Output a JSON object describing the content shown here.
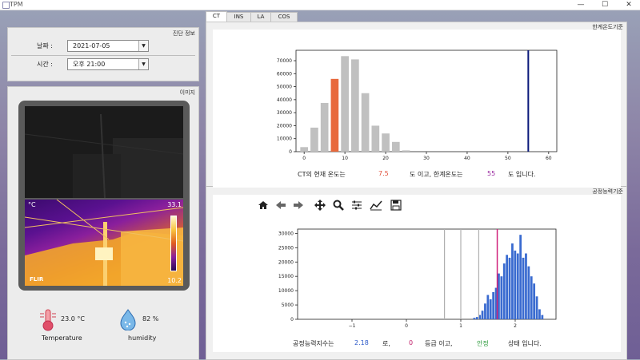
{
  "window": {
    "title": "TPM",
    "minimize": "—",
    "maximize": "☐",
    "close": "✕"
  },
  "diag": {
    "title": "진단 정보",
    "date_label": "날짜 :",
    "date_value": "2021-07-05",
    "time_label": "시간 :",
    "time_value": "오후 21:00"
  },
  "image_panel": {
    "title": "이미지",
    "camera": {
      "unit_label": "°C",
      "max_temp": "33.1",
      "min_temp": "10.2",
      "brand": "FLIR"
    }
  },
  "sensors": {
    "temperature_value": "23.0 °C",
    "temperature_label": "Temperature",
    "humidity_value": "82 %",
    "humidity_label": "humidity"
  },
  "tabs": [
    "CT",
    "INS",
    "LA",
    "COS"
  ],
  "limit_chart": {
    "group_title": "한계온도기준",
    "info": {
      "prefix": "CT의 현재 온도는",
      "current": "7.5",
      "mid": "도 이고, 한계온도는",
      "limit": "55",
      "suffix": "도 입니다."
    },
    "colors": {
      "bar": "#c0c0c0",
      "highlight": "#e8693c",
      "limit_line": "#0a1a7a",
      "current_text": "#e0503a",
      "limit_text": "#9a2aa0"
    }
  },
  "capability_chart": {
    "group_title": "공정능력기준",
    "toolbar": [
      "home-icon",
      "back-icon",
      "forward-icon",
      "pan-icon",
      "zoom-icon",
      "configure-icon",
      "edit-curve-icon",
      "save-icon"
    ],
    "info": {
      "prefix": "공정능력지수는",
      "index": "2.18",
      "mid1": "로,",
      "grade": "0",
      "mid2": "등급 이고,",
      "status": "안정",
      "suffix": "상태 입니다."
    },
    "colors": {
      "bar": "#3a6bd0",
      "grey_lines": "#b0b0b0",
      "marker": "#d0207a",
      "index_text": "#2a58c8",
      "grade_text": "#c0206a",
      "status_text": "#2a9a3a"
    }
  },
  "chart_data": [
    {
      "type": "bar",
      "x": [
        0,
        2.5,
        5,
        7.5,
        10,
        12.5,
        15,
        17.5,
        20,
        22.5,
        25
      ],
      "values": [
        3500,
        18500,
        37500,
        56000,
        73500,
        71000,
        45000,
        20000,
        14000,
        7500,
        1000
      ],
      "highlight_x": 7.5,
      "vline": 55,
      "xlim": [
        -2,
        62
      ],
      "ylim": [
        0,
        78000
      ],
      "xticks": [
        0,
        10,
        20,
        30,
        40,
        50,
        60
      ],
      "yticks": [
        0,
        10000,
        20000,
        30000,
        40000,
        50000,
        60000,
        70000
      ]
    },
    {
      "type": "bar",
      "x": [
        1.25,
        1.3,
        1.35,
        1.4,
        1.45,
        1.5,
        1.55,
        1.6,
        1.65,
        1.7,
        1.75,
        1.8,
        1.85,
        1.9,
        1.95,
        2.0,
        2.05,
        2.1,
        2.15,
        2.2,
        2.25,
        2.3,
        2.35,
        2.4,
        2.45,
        2.5
      ],
      "values": [
        500,
        800,
        1500,
        3000,
        5500,
        8500,
        7000,
        9500,
        11000,
        16000,
        15000,
        19500,
        22500,
        21500,
        26500,
        24000,
        23000,
        29500,
        21500,
        23000,
        18500,
        15000,
        12500,
        8000,
        3500,
        1500
      ],
      "vlines_grey": [
        0.7,
        1.0,
        1.33
      ],
      "marker_line": 1.67,
      "xlim": [
        -2.0,
        2.75
      ],
      "ylim": [
        0,
        31500
      ],
      "xticks": [
        -1,
        0,
        1,
        2
      ],
      "yticks": [
        0,
        5000,
        10000,
        15000,
        20000,
        25000,
        30000
      ]
    }
  ]
}
